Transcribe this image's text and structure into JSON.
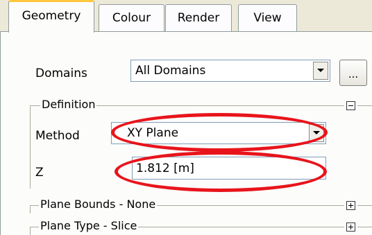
{
  "tabs": [
    {
      "label": "Geometry",
      "active": true
    },
    {
      "label": "Colour",
      "active": false
    },
    {
      "label": "Render",
      "active": false
    },
    {
      "label": "View",
      "active": false
    }
  ],
  "domains": {
    "label": "Domains",
    "value": "All Domains",
    "browse_label": "..."
  },
  "definition": {
    "title": "Definition",
    "method_label": "Method",
    "method_value": "XY Plane",
    "z_label": "Z",
    "z_value": "1.812 [m]"
  },
  "sections": [
    {
      "title": "Plane Bounds - None",
      "collapsed": true
    },
    {
      "title": "Plane Type - Slice",
      "collapsed": true
    }
  ],
  "colors": {
    "highlight": "#e8141b",
    "active_tab_accent": "#ffc83c"
  }
}
